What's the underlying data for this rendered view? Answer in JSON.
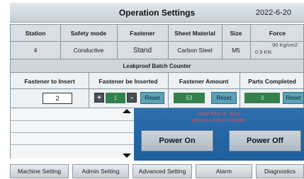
{
  "title": "Operation Settings",
  "date": "2022-6-20",
  "table": {
    "headers": [
      "Station",
      "Safety mode",
      "Fastener",
      "Sheet Material",
      "Size",
      "Force"
    ],
    "values": [
      "4",
      "Conductive",
      "Stand",
      "Carbon Steel",
      "M5"
    ],
    "force_line1": "90 Kg/cm2",
    "force_line2": "0.9      KN"
  },
  "leak_banner": "Leakproof Batch Counter",
  "counter": {
    "headers": [
      "Fastener to Insert",
      "Fastener be Inserted",
      "Fastener Amount",
      "Parts Completed"
    ],
    "insert_value": "2",
    "inserted_value": "1",
    "amount_value": "53",
    "completed_value": "3",
    "minus_label": "-",
    "plus_label": "+",
    "reset_label": "Reset"
  },
  "alert": {
    "line1": "Valid time is: @yy",
    "line2": "please contact supplier"
  },
  "power": {
    "on_label": "Power On",
    "off_label": "Power Off"
  },
  "nav": [
    "Machine Setting",
    "Admin Setting",
    "Advanced Setting",
    "Alarm",
    "Diagnostics"
  ],
  "colors": {
    "accent_blue": "#2c6fae",
    "field_green": "#34814b",
    "reset_teal": "#5ba2b6",
    "alert_red": "#e05050"
  }
}
